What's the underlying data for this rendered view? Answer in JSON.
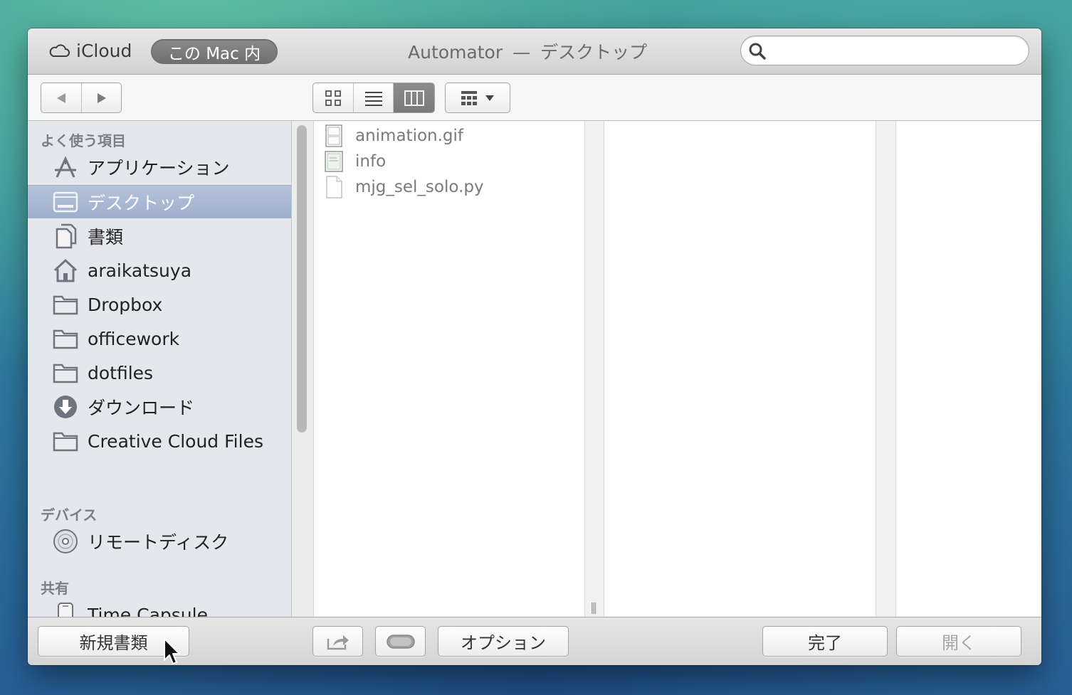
{
  "titlebar": {
    "icloud_label": "iCloud",
    "location_pill": "この Mac 内",
    "app_name": "Automator",
    "separator": "—",
    "folder_name": "デスクトップ",
    "search_placeholder": ""
  },
  "sidebar": {
    "favorites_header": "よく使う項目",
    "favorites": [
      {
        "label": "アプリケーション",
        "icon": "applications-icon"
      },
      {
        "label": "デスクトップ",
        "icon": "desktop-icon",
        "selected": true
      },
      {
        "label": "書類",
        "icon": "documents-icon"
      },
      {
        "label": "araikatsuya",
        "icon": "home-icon"
      },
      {
        "label": "Dropbox",
        "icon": "folder-icon"
      },
      {
        "label": "officework",
        "icon": "folder-icon"
      },
      {
        "label": "dotfiles",
        "icon": "folder-icon"
      },
      {
        "label": "ダウンロード",
        "icon": "downloads-icon"
      },
      {
        "label": "Creative Cloud Files",
        "icon": "folder-icon"
      }
    ],
    "devices_header": "デバイス",
    "devices": [
      {
        "label": "リモートディスク",
        "icon": "disc-icon"
      }
    ],
    "shared_header": "共有",
    "shared": [
      {
        "label": "Time Capsule",
        "icon": "time-capsule-icon"
      }
    ]
  },
  "files": [
    {
      "name": "animation.gif",
      "icon": "image-file-icon"
    },
    {
      "name": "info",
      "icon": "text-file-icon"
    },
    {
      "name": "mjg_sel_solo.py",
      "icon": "document-file-icon"
    }
  ],
  "bottom": {
    "new_document": "新規書類",
    "options": "オプション",
    "done": "完了",
    "open": "開く"
  },
  "colors": {
    "selection": "#a9b8d3",
    "active_pill": "#7b7b7b"
  }
}
